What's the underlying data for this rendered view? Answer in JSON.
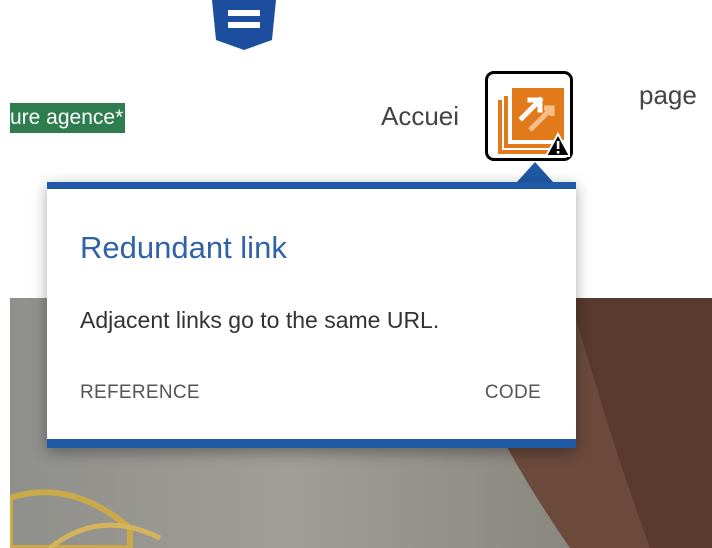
{
  "header": {
    "highlighted_text": "ure agence*",
    "nav_accueil": "Accuei",
    "nav_page": "page"
  },
  "tooltip": {
    "title": "Redundant link",
    "message": "Adjacent links go to the same URL.",
    "reference_label": "REFERENCE",
    "code_label": "CODE"
  },
  "icons": {
    "logo": "shield-logo-icon",
    "alert_flag": "redundant-link-alert-icon",
    "warning": "warning-triangle-icon"
  },
  "colors": {
    "tooltip_border": "#1f5aa6",
    "tooltip_title": "#2f63a8",
    "highlight_bg": "#2e7d4f",
    "icon_orange": "#e07a1a",
    "logo_blue": "#1d4e9e"
  }
}
